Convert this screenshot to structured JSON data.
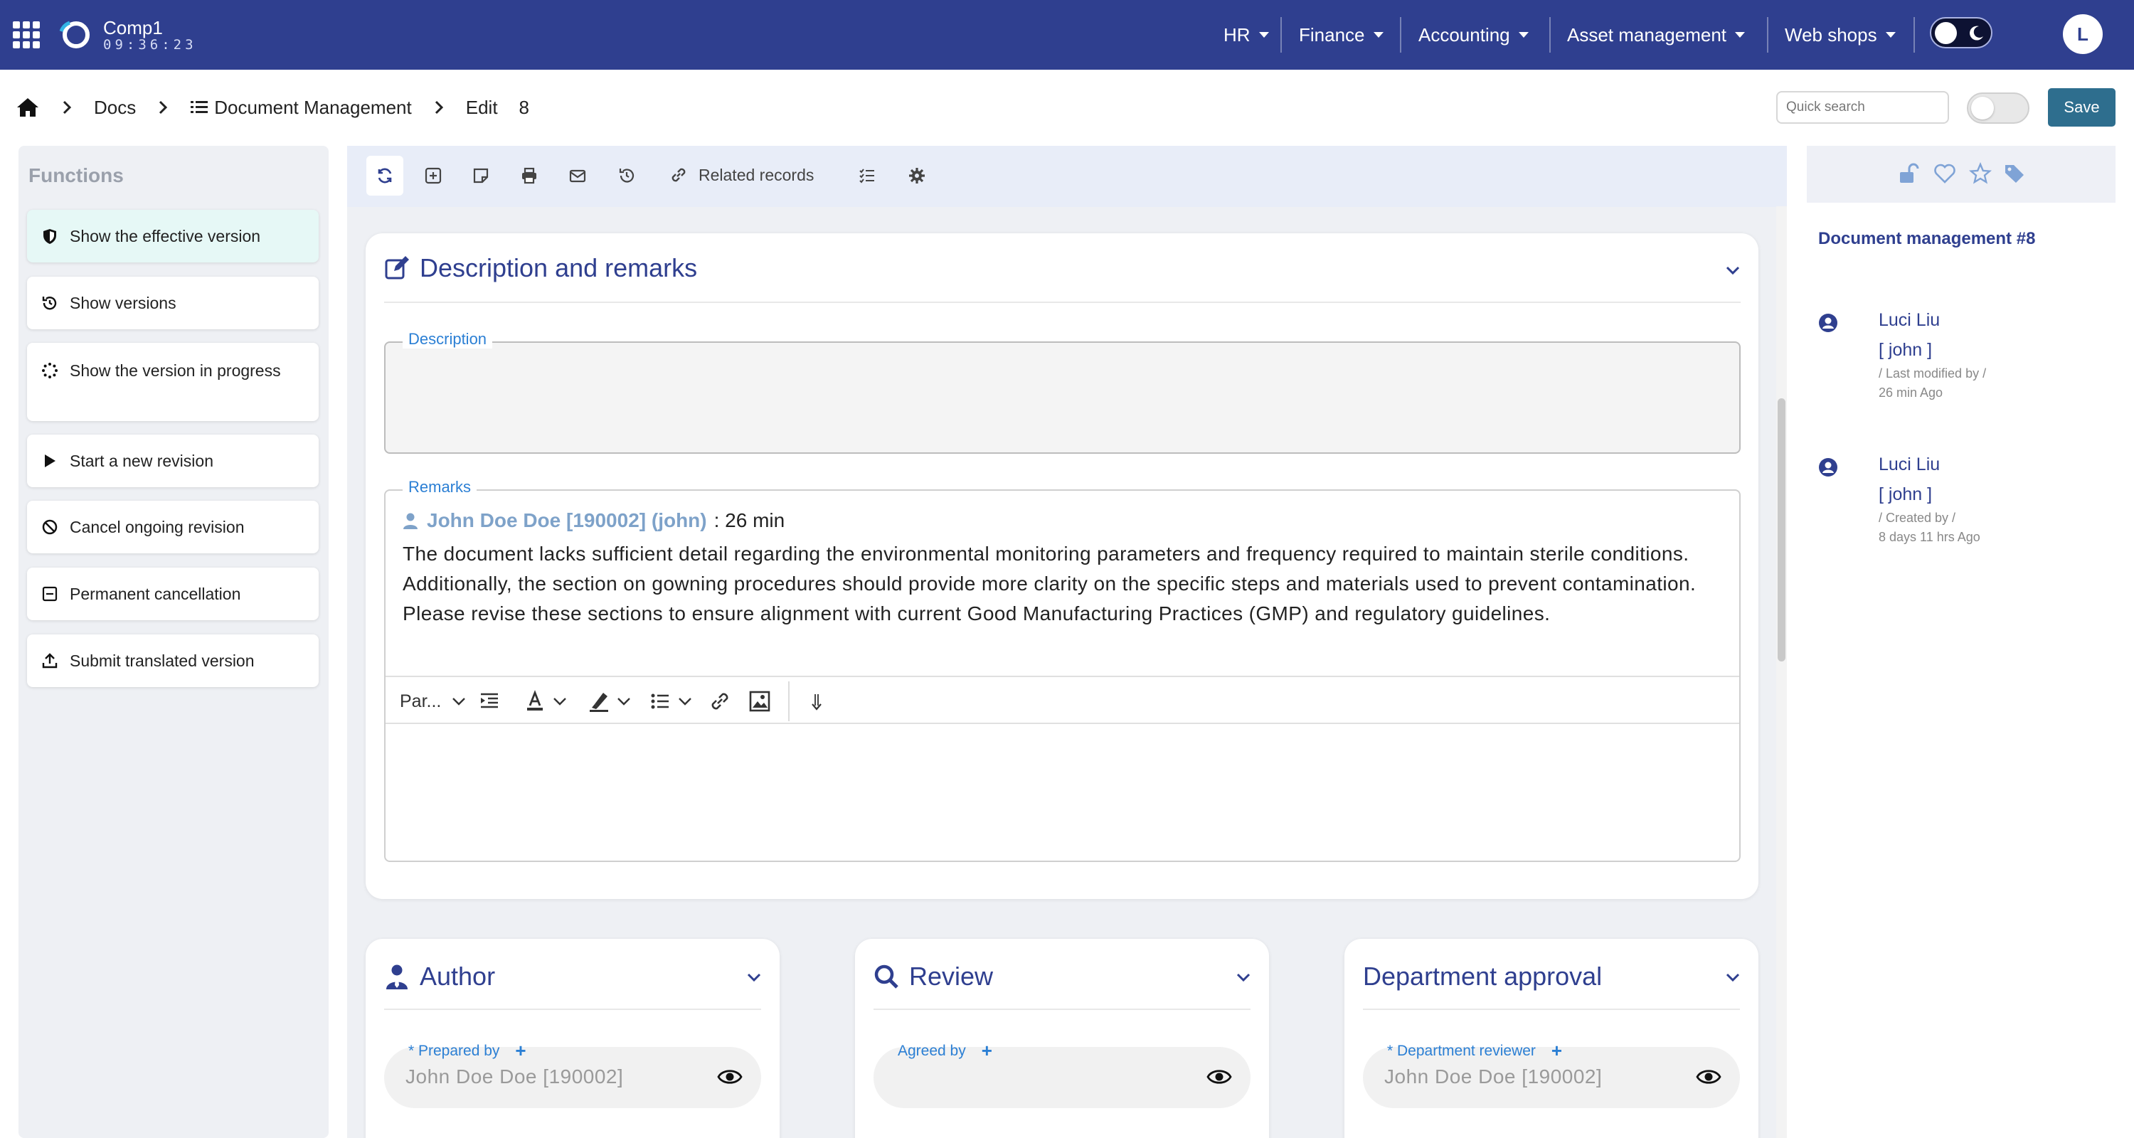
{
  "topbar": {
    "app_name": "Comp1",
    "clock": "09:36:23",
    "nav": [
      "HR",
      "Finance",
      "Accounting",
      "Asset management",
      "Web shops"
    ],
    "avatar_initial": "L",
    "accent_color": "#2f3f8f"
  },
  "breadcrumb": {
    "docs": "Docs",
    "module": "Document Management",
    "mode": "Edit",
    "record_number": "8"
  },
  "header_actions": {
    "search_placeholder": "Quick search",
    "save_label": "Save"
  },
  "functions": {
    "title": "Functions",
    "items": [
      {
        "label": "Show the effective version",
        "icon": "shield-icon"
      },
      {
        "label": "Show versions",
        "icon": "history-icon"
      },
      {
        "label": "Show the version in progress",
        "icon": "spinner-icon"
      },
      {
        "label": "Start a new revision",
        "icon": "play-icon"
      },
      {
        "label": "Cancel ongoing revision",
        "icon": "ban-icon"
      },
      {
        "label": "Permanent cancellation",
        "icon": "minus-square-icon"
      },
      {
        "label": "Submit translated version",
        "icon": "upload-icon"
      }
    ]
  },
  "toolbar": {
    "related_records_label": "Related records"
  },
  "description_card": {
    "title": "Description and remarks",
    "description_label": "Description",
    "description_value": "",
    "remarks_label": "Remarks",
    "remark": {
      "author": "John Doe Doe [190002] (john)",
      "time": ": 26 min",
      "text": "The document lacks sufficient detail regarding the environmental monitoring parameters and frequency required to maintain sterile conditions. Additionally, the section on gowning procedures should provide more clarity on the specific steps and materials used to prevent contamination. Please revise these sections to ensure alignment with current Good Manufacturing Practices (GMP) and regulatory guidelines."
    },
    "editor": {
      "format_label": "Par...",
      "body": ""
    }
  },
  "author_card": {
    "title": "Author",
    "field_label": "* Prepared by",
    "plus": "+",
    "value": "John Doe Doe [190002]"
  },
  "review_card": {
    "title": "Review",
    "field_label": "Agreed by",
    "plus": "+",
    "value": ""
  },
  "department_card": {
    "title": "Department approval",
    "field_label": "* Department reviewer",
    "plus": "+",
    "value": "John Doe Doe [190002]"
  },
  "right_panel": {
    "title": "Document management #8",
    "activity": [
      {
        "name": "Luci Liu",
        "user": "[ john ]",
        "action": "/ Last modified by /",
        "when": "26 min Ago"
      },
      {
        "name": "Luci Liu",
        "user": "[ john ]",
        "action": "/ Created by /",
        "when": "8 days 11 hrs Ago"
      }
    ]
  }
}
